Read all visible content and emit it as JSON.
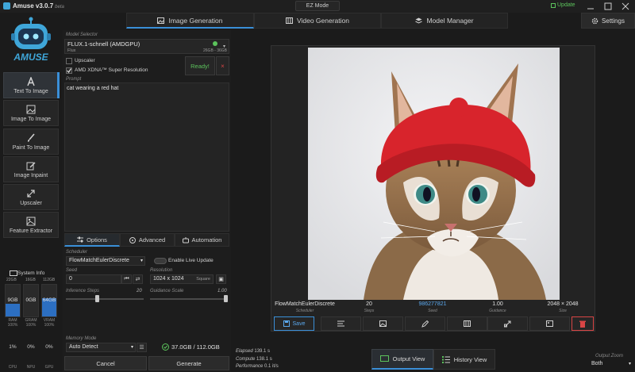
{
  "app": {
    "title": "Amuse v3.0.7",
    "beta": "beta",
    "mode_button": "EZ Mode",
    "update_label": "Update"
  },
  "tabs": [
    {
      "label": "Image Generation",
      "active": true
    },
    {
      "label": "Video Generation",
      "active": false
    },
    {
      "label": "Model Manager",
      "active": false
    }
  ],
  "settings_label": "Settings",
  "logo_text": "AMUSE",
  "sidebar": {
    "items": [
      {
        "label": "Text To Image",
        "icon": "text-a-icon",
        "active": true
      },
      {
        "label": "Image To Image",
        "icon": "image-icon",
        "active": false
      },
      {
        "label": "Paint To Image",
        "icon": "brush-icon",
        "active": false
      },
      {
        "label": "Image Inpaint",
        "icon": "edit-icon",
        "active": false
      },
      {
        "label": "Upscaler",
        "icon": "expand-icon",
        "active": false
      },
      {
        "label": "Feature Extractor",
        "icon": "image-icon",
        "active": false
      }
    ]
  },
  "system_info": {
    "title": "System Info",
    "totals": [
      "22GB",
      "16GB",
      "112GB"
    ],
    "memory": [
      {
        "value": "9GB",
        "sub": "RAM",
        "level": 0.41
      },
      {
        "value": "0GB",
        "sub": "GRAM",
        "level": 0.0
      },
      {
        "value": "64GB",
        "sub": "VRAM",
        "level": 0.57
      }
    ],
    "hundred": "100%",
    "usage": [
      {
        "value": "1%",
        "label": "CPU"
      },
      {
        "value": "0%",
        "label": "NPU"
      },
      {
        "value": "0%",
        "label": "GPU"
      }
    ]
  },
  "model": {
    "label": "Model Selector",
    "name": "FLUX.1-schnell (AMDGPU)",
    "family": "Flux",
    "size": "26GB - 36GB",
    "status_color": "#5cc35c"
  },
  "upscaler": {
    "label": "Upscaler",
    "checked": false
  },
  "super_res": {
    "label": "AMD XDNA™ Super Resolution",
    "checked": true
  },
  "ready": {
    "label": "Ready!",
    "close": "×"
  },
  "prompt": {
    "label": "Prompt",
    "value": "cat wearing a red hat"
  },
  "subtabs": [
    {
      "label": "Options",
      "active": true
    },
    {
      "label": "Advanced",
      "active": false
    },
    {
      "label": "Automation",
      "active": false
    }
  ],
  "options": {
    "scheduler_label": "Scheduler",
    "scheduler_value": "FlowMatchEulerDiscrete",
    "live_update_label": "Enable Live Update",
    "seed_label": "Seed",
    "seed_value": "0",
    "resolution_label": "Resolution",
    "resolution_value": "1024 x 1024",
    "resolution_preset": "Square",
    "steps_label": "Inference Steps",
    "steps_value": "20",
    "steps_level": 0.4,
    "guidance_label": "Guidance Scale",
    "guidance_value": "1.00",
    "guidance_level": 0.0
  },
  "memory_mode": {
    "label": "Memory Mode",
    "value": "Auto Detect",
    "usage": "37.0GB / 112.0GB"
  },
  "actions": {
    "cancel": "Cancel",
    "generate": "Generate"
  },
  "output_meta": [
    {
      "value": "FlowMatchEulerDiscrete",
      "label": "Scheduler"
    },
    {
      "value": "20",
      "label": "Steps"
    },
    {
      "value": "986277821",
      "label": "Seed"
    },
    {
      "value": "1.00",
      "label": "Guidance"
    },
    {
      "value": "2048 × 2048",
      "label": "Size"
    }
  ],
  "toolbar": {
    "save": "Save"
  },
  "stats": {
    "elapsed_label": "Elapsed",
    "elapsed": "139.1 s",
    "compute_label": "Compute",
    "compute": "138.1 s",
    "performance_label": "Performance",
    "performance": "0.1 it/s"
  },
  "views": {
    "output": "Output View",
    "history": "History View"
  },
  "zoom": {
    "label": "Output Zoom",
    "value": "Both"
  },
  "colors": {
    "accent": "#3a8fd8",
    "ready": "#5cc35c",
    "danger": "#d84545",
    "seed": "#5aa8ee"
  }
}
